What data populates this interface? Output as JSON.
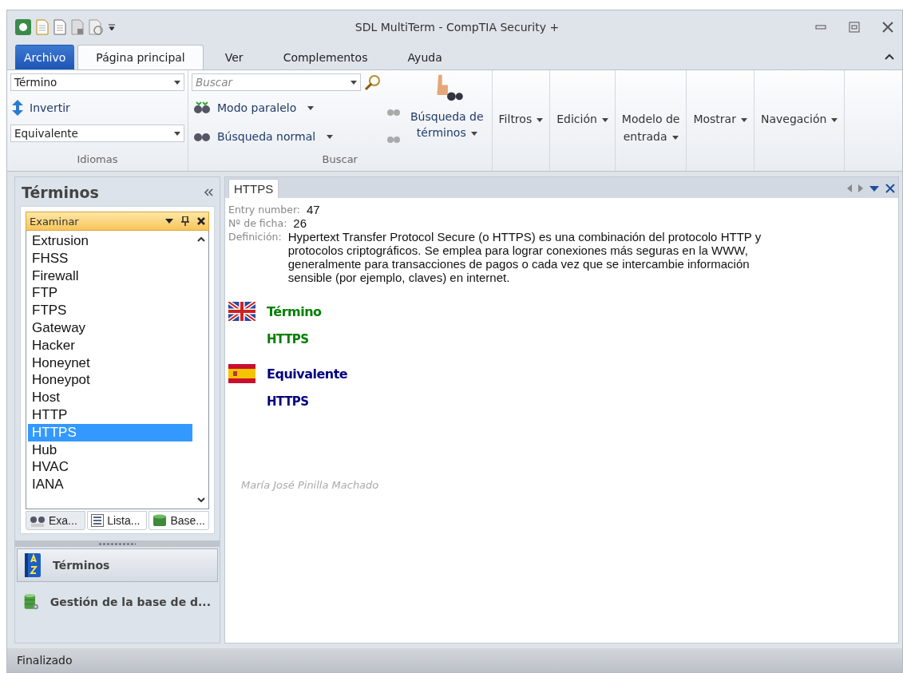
{
  "window": {
    "title": "SDL MultiTerm - CompTIA Security +"
  },
  "ribbon_tabs": [
    {
      "label": "Archivo",
      "kind": "file",
      "selected": false
    },
    {
      "label": "Página principal",
      "kind": "tab",
      "selected": true
    },
    {
      "label": "Ver",
      "kind": "tab",
      "selected": false
    },
    {
      "label": "Complementos",
      "kind": "tab",
      "selected": false
    },
    {
      "label": "Ayuda",
      "kind": "tab",
      "selected": false
    }
  ],
  "languages_group": {
    "source": "Término",
    "invert": "Invertir",
    "target": "Equivalente",
    "label": "Idiomas"
  },
  "search_group": {
    "placeholder": "Buscar",
    "parallel_mode": "Modo paralelo",
    "normal_search": "Búsqueda normal",
    "term_search": "Búsqueda de\ntérminos",
    "label": "Buscar"
  },
  "ribbon_menus": [
    {
      "label": "Filtros"
    },
    {
      "label": "Edición"
    },
    {
      "label": "Modelo de\nentrada"
    },
    {
      "label": "Mostrar"
    },
    {
      "label": "Navegación"
    }
  ],
  "sidebar": {
    "title": "Términos",
    "browse_panel": "Examinar",
    "items": [
      {
        "label": "Extrusion",
        "selected": false
      },
      {
        "label": "FHSS",
        "selected": false
      },
      {
        "label": "Firewall",
        "selected": false
      },
      {
        "label": "FTP",
        "selected": false
      },
      {
        "label": "FTPS",
        "selected": false
      },
      {
        "label": "Gateway",
        "selected": false
      },
      {
        "label": "Hacker",
        "selected": false
      },
      {
        "label": "Honeynet",
        "selected": false
      },
      {
        "label": "Honeypot",
        "selected": false
      },
      {
        "label": "Host",
        "selected": false
      },
      {
        "label": "HTTP",
        "selected": false
      },
      {
        "label": "HTTPS",
        "selected": true
      },
      {
        "label": "Hub",
        "selected": false
      },
      {
        "label": "HVAC",
        "selected": false
      },
      {
        "label": "IANA",
        "selected": false
      }
    ],
    "panel_tabs": [
      {
        "label": "Exa...",
        "kind": "browse",
        "selected": true
      },
      {
        "label": "Lista...",
        "kind": "list",
        "selected": false
      },
      {
        "label": "Base...",
        "kind": "database",
        "selected": false
      }
    ],
    "nav_buttons": [
      {
        "label": "Términos",
        "kind": "terms",
        "selected": true
      },
      {
        "label": "Gestión de la base de d...",
        "kind": "database",
        "selected": false
      }
    ]
  },
  "entry": {
    "tab": "HTTPS",
    "fields": [
      {
        "label": "Entry number:",
        "value": "47"
      },
      {
        "label": "Nº de ficha:",
        "value": "26"
      },
      {
        "label": "Definición:",
        "value": "Hypertext Transfer Protocol Secure (o HTTPS) es una combinación del protocolo HTTP y protocolos criptográficos. Se emplea para lograr conexiones más seguras en la WWW, generalmente para transacciones de pagos o cada vez que se intercambie información sensible (por ejemplo, claves) en internet."
      }
    ],
    "languages": [
      {
        "kind": "uk",
        "heading": "Término",
        "term": "HTTPS",
        "color": "#008000"
      },
      {
        "kind": "es",
        "heading": "Equivalente",
        "term": "HTTPS",
        "color": "#000080"
      }
    ],
    "author": "María José Pinilla Machado"
  },
  "status_bar": {
    "text": "Finalizado"
  }
}
